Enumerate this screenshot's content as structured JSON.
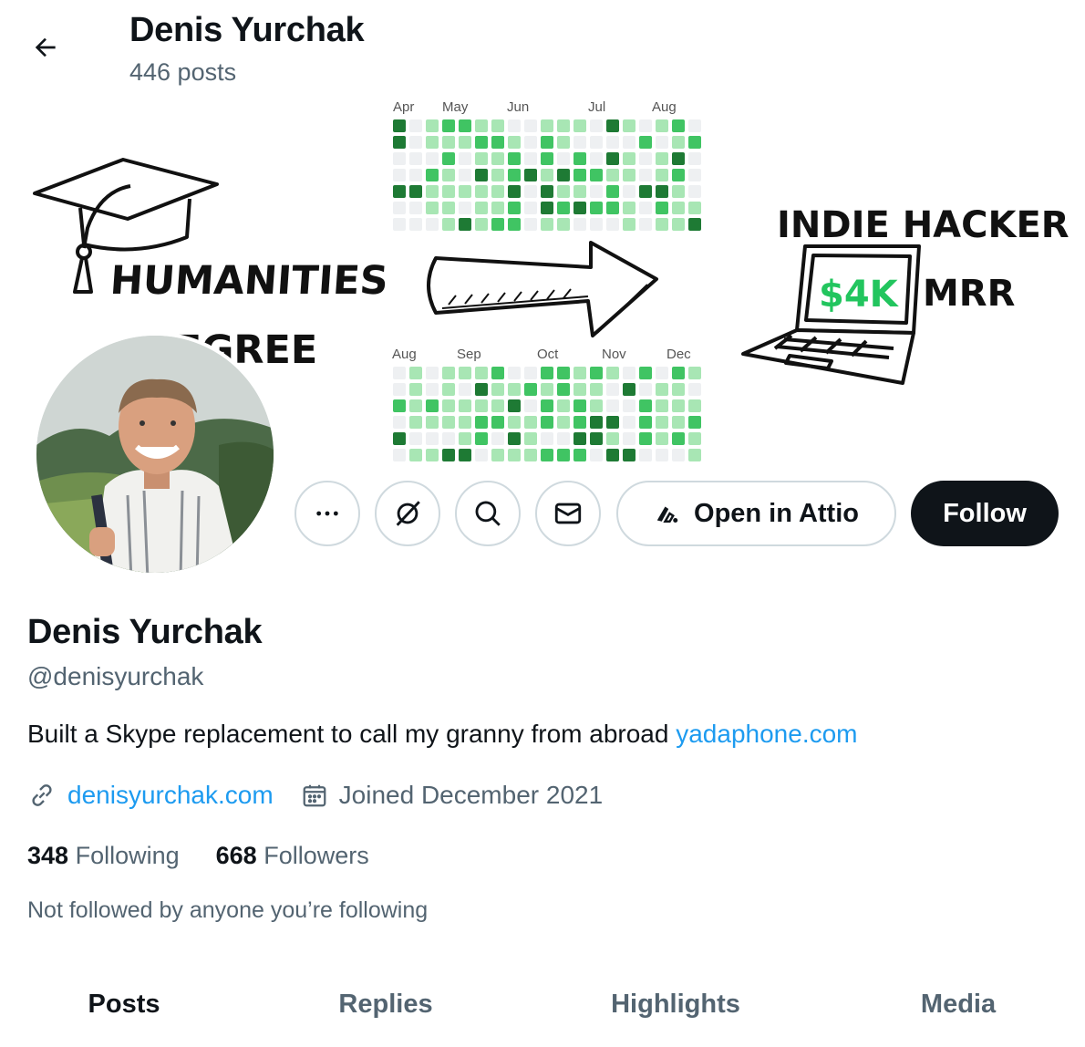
{
  "header": {
    "name": "Denis Yurchak",
    "posts_count": "446 posts"
  },
  "banner": {
    "left_text_1": "HUMANITIES",
    "left_text_2": "DEGREE",
    "right_text": "INDIE HACKER",
    "screen_text": "$4K",
    "mrr_text": "MRR",
    "top_months": [
      "Apr",
      "May",
      "Jun",
      "Jul",
      "Aug"
    ],
    "bottom_months": [
      "Aug",
      "Sep",
      "Oct",
      "Nov",
      "Dec"
    ],
    "colors": {
      "green_light": "#a8e6b4",
      "green_mid": "#40c463",
      "green_dark": "#1e7a34",
      "empty": "#eef0f2",
      "screen_green": "#22c55e"
    }
  },
  "actions": {
    "more_icon": "more-icon",
    "grok_icon": "grok-icon",
    "search_icon": "search-icon",
    "message_icon": "envelope-icon",
    "attio_label": "Open in Attio",
    "follow_label": "Follow"
  },
  "profile": {
    "name": "Denis Yurchak",
    "handle": "@denisyurchak",
    "bio_text": "Built a Skype replacement to call my granny from abroad ",
    "bio_link": "yadaphone.com",
    "website": "denisyurchak.com",
    "joined": "Joined December 2021",
    "following_count": "348",
    "following_label": "Following",
    "followers_count": "668",
    "followers_label": "Followers",
    "not_followed": "Not followed by anyone you’re following"
  },
  "tabs": [
    {
      "label": "Posts",
      "active": true
    },
    {
      "label": "Replies",
      "active": false
    },
    {
      "label": "Highlights",
      "active": false
    },
    {
      "label": "Media",
      "active": false
    }
  ],
  "colors": {
    "link": "#1d9bf0",
    "muted": "#536471",
    "text": "#0f1419",
    "border": "#cfd9de"
  }
}
